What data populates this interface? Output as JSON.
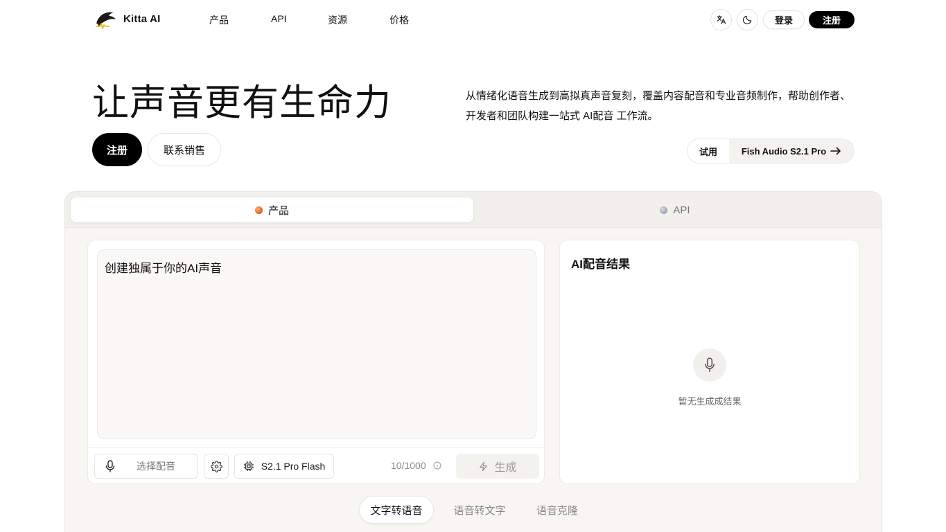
{
  "header": {
    "brand": "Kitta AI",
    "nav": [
      "产品",
      "API",
      "资源",
      "价格"
    ],
    "login": "登录",
    "signup": "注册"
  },
  "hero": {
    "title": "让声音更有生命力",
    "description": "从情绪化语音生成到高拟真声音复刻，覆盖内容配音和专业音频制作，帮助创作者、开发者和团队构建一站式 AI配音 工作流。",
    "signup": "注册",
    "contact_sales": "联系销售",
    "try_label": "试用",
    "try_model": "Fish Audio S2.1 Pro"
  },
  "demo": {
    "tabs": [
      {
        "label": "产品",
        "active": true
      },
      {
        "label": "API",
        "active": false
      }
    ],
    "editor": {
      "text": "创建独属于你的AI声音",
      "select_voice": "选择配音",
      "model": "S2.1 Pro Flash",
      "char_count": "10/1000",
      "generate": "生成"
    },
    "result": {
      "title": "AI配音结果",
      "empty": "暂无生成成结果"
    },
    "modes": [
      {
        "label": "文字转语音",
        "active": true
      },
      {
        "label": "语音转文字",
        "active": false
      },
      {
        "label": "语音克隆",
        "active": false
      }
    ]
  }
}
